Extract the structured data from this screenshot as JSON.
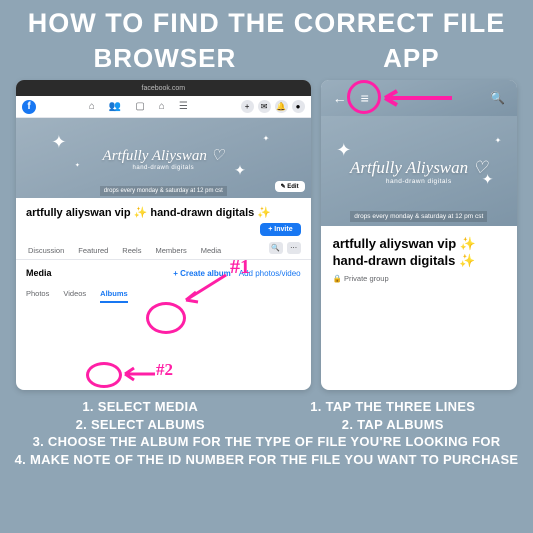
{
  "title": "HOW TO FIND THE CORRECT FILE",
  "subtitles": {
    "left": "BROWSER",
    "right": "APP"
  },
  "browser": {
    "url": "facebook.com",
    "logo_letter": "f",
    "nav_icons": [
      "home",
      "friends",
      "video",
      "market",
      "groups",
      "menu"
    ],
    "right_icons": [
      "plus",
      "messenger",
      "bell",
      "avatar"
    ],
    "cover": {
      "brand": "Artfully Aliyswan ♡",
      "subtitle": "hand-drawn digitals",
      "drop_text": "drops every monday & saturday at 12 pm cst",
      "edit_label": "✎ Edit"
    },
    "group_title": "artfully aliyswan vip ✨ hand-drawn digitals ✨",
    "invite_label": "+ Invite",
    "tabs": [
      "Discussion",
      "Featured",
      "Reels",
      "Members",
      "Media"
    ],
    "media": {
      "header": "Media",
      "create_album": "+ Create album",
      "add_photos": "Add photos/video",
      "subtabs": [
        "Photos",
        "Videos",
        "Albums"
      ]
    },
    "annotations": {
      "tag1": "#1",
      "tag2": "#2"
    }
  },
  "app": {
    "cover": {
      "brand": "Artfully Aliyswan ♡",
      "subtitle": "hand-drawn digitals",
      "drop_text": "drops every monday & saturday at 12 pm cst"
    },
    "group_title_line1": "artfully aliyswan vip ✨",
    "group_title_line2": "hand-drawn digitals ✨",
    "privacy": "🔒 Private group"
  },
  "instructions": {
    "browser": [
      "1. SELECT MEDIA",
      "2. SELECT ALBUMS"
    ],
    "app": [
      "1. TAP THE THREE LINES",
      "2. TAP ALBUMS"
    ],
    "shared": [
      "3. CHOOSE THE ALBUM FOR THE TYPE OF FILE YOU'RE LOOKING FOR",
      "4. MAKE NOTE OF THE ID NUMBER FOR THE FILE YOU WANT TO PURCHASE"
    ]
  }
}
